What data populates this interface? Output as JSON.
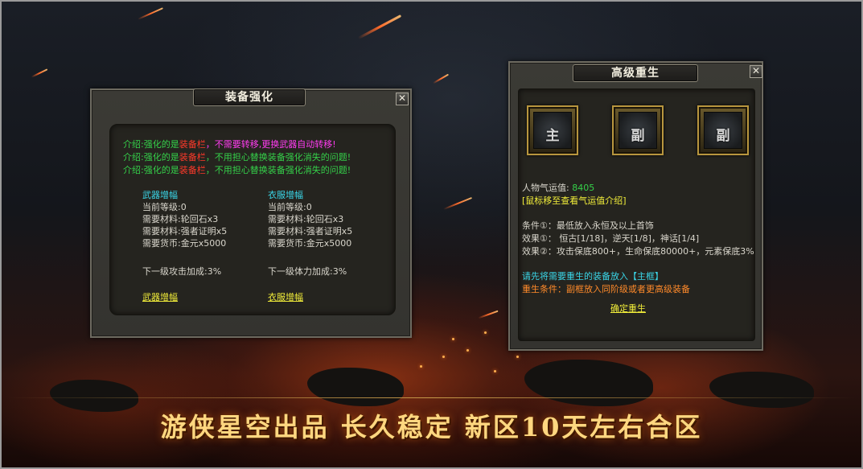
{
  "enhance_panel": {
    "title": "装备强化",
    "close_label": "✕",
    "intro_lines": [
      {
        "prefix": "介绍:强化的是",
        "highlight": "装备栏",
        "suffix": "，不需要转移,更换武器自动转移!"
      },
      {
        "prefix": "介绍:强化的是",
        "highlight": "装备栏",
        "suffix": "，不用担心替换装备强化消失的问题!"
      },
      {
        "prefix": "介绍:强化的是",
        "highlight": "装备栏",
        "suffix": "，不用担心替换装备强化消失的问题!"
      }
    ],
    "weapon": {
      "header": "武器增幅",
      "level": "当前等级:0",
      "material1": "需要材料:轮回石x3",
      "material2": "需要材料:强者证明x5",
      "currency": "需要货币:金元x5000",
      "bonus": "下一级攻击加成:3%",
      "action": "武器增幅"
    },
    "armor": {
      "header": "衣服增幅",
      "level": "当前等级:0",
      "material1": "需要材料:轮回石x3",
      "material2": "需要材料:强者证明x5",
      "currency": "需要货币:金元x5000",
      "bonus": "下一级体力加成:3%",
      "action": "衣服增幅"
    }
  },
  "rebirth_panel": {
    "title": "高级重生",
    "close_label": "✕",
    "slots": [
      "主",
      "副",
      "副"
    ],
    "popularity_label": "人物气运值:",
    "popularity_value": "8405",
    "hover_hint": "[鼠标移至查看气运值介绍]",
    "condition1": "条件①：最低放入永恒及以上首饰",
    "effect1": "效果①：  恒古[1/18]，逆天[1/8]，神话[1/4]",
    "effect2": "效果②：攻击保底800+，生命保底80000+，元素保底3%",
    "instruction": "请先将需要重生的装备放入【主框】",
    "rebirth_condition": "重生条件：副框放入同阶级或者更高级装备",
    "confirm": "确定重生"
  },
  "banner": "游侠星空出品 长久稳定 新区10天左右合区",
  "colors": {
    "green": "#35d14a",
    "red": "#ff3a2a",
    "magenta": "#ff3cf0",
    "cyan": "#3ad6e8",
    "yellow": "#f2ee3a",
    "orange": "#ff8a2a",
    "banner_gold": "#ffd780"
  }
}
